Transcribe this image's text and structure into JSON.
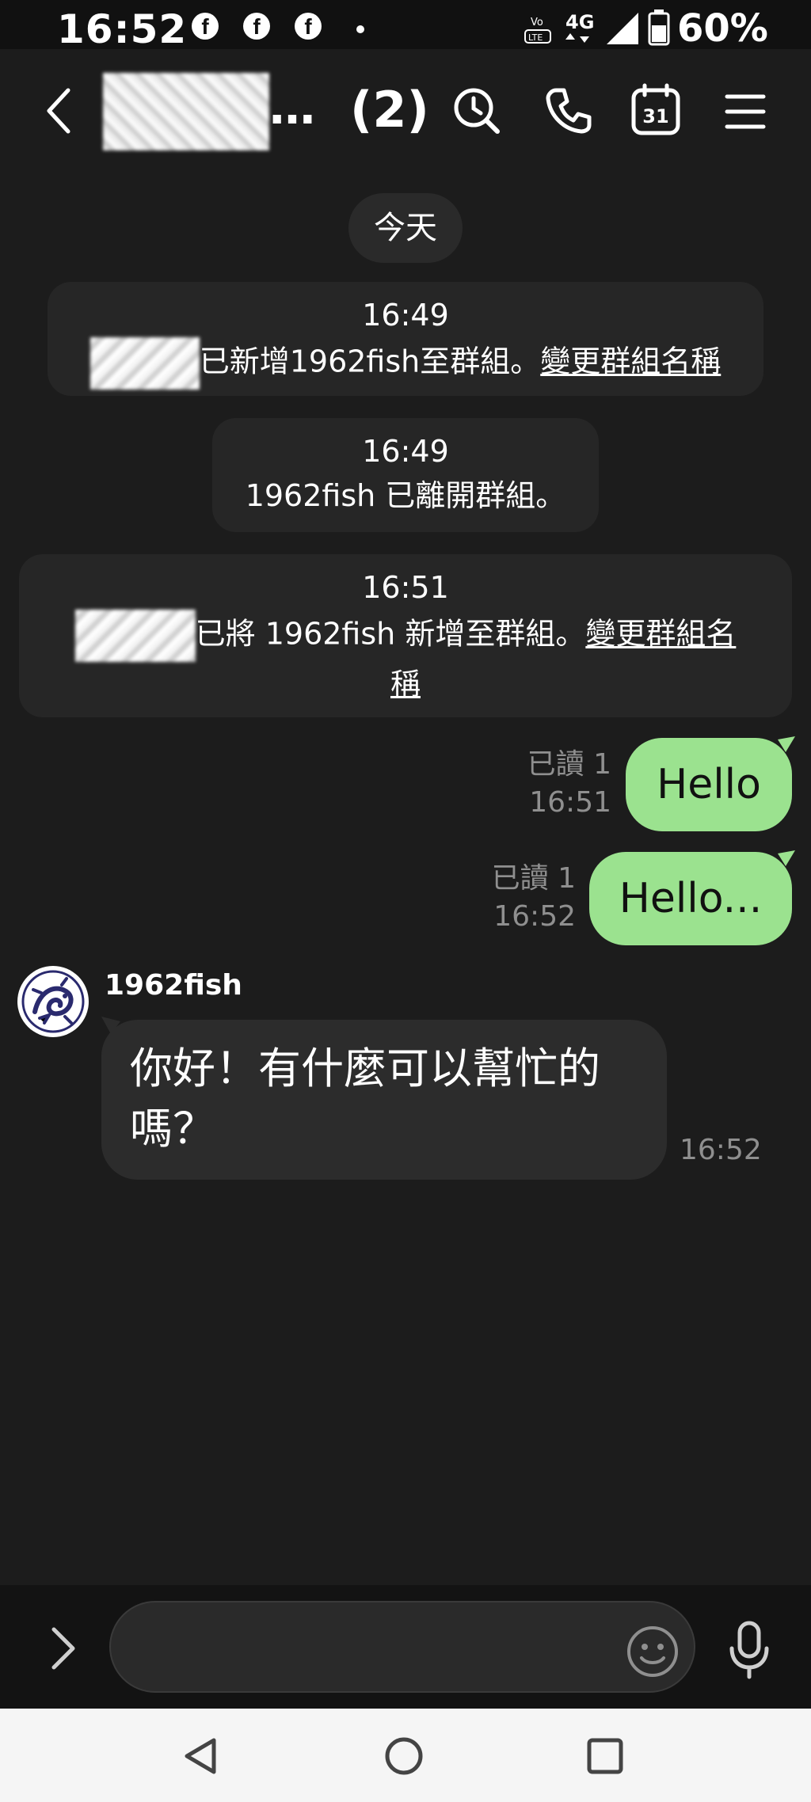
{
  "status_bar": {
    "time": "16:52",
    "notification_icons": [
      "facebook-icon",
      "facebook-icon",
      "facebook-icon"
    ],
    "network": "4G",
    "battery": "60%"
  },
  "header": {
    "group_name": "…",
    "member_count": "(2)",
    "calendar_day": "31"
  },
  "chat": {
    "date_label": "今天",
    "system_messages": [
      {
        "time": "16:49",
        "text": "已新增1962fish至群組。",
        "link": "變更群組名稱"
      },
      {
        "time": "16:49",
        "text": "1962fish 已離開群組。",
        "link": ""
      },
      {
        "time": "16:51",
        "text": "已將 1962fish 新增至群組。",
        "link_line1": "變更群組名",
        "link_line2": "稱"
      }
    ],
    "sent_messages": [
      {
        "text": "Hello",
        "read": "已讀 1",
        "time": "16:51"
      },
      {
        "text": "Hello...",
        "read": "已讀 1",
        "time": "16:52"
      }
    ],
    "received_message": {
      "sender": "1962fish",
      "line1": "你好！有什麼可以幫忙的",
      "line2": "嗎？",
      "time": "16:52"
    }
  },
  "colors": {
    "background": "#1c1c1c",
    "sent_bubble": "#9be28f",
    "received_bubble": "#2c2c2c",
    "system_bubble": "#262626",
    "meta_text": "#8f8f8f"
  }
}
